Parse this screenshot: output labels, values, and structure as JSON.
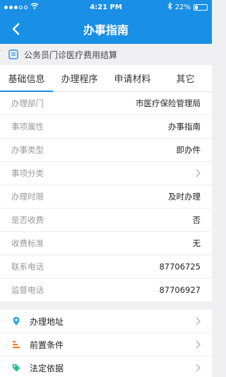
{
  "status_bar": {
    "time": "4:21 PM",
    "battery_percent": "22%",
    "battery_level": 0.22,
    "wifi_icon": "wifi-icon",
    "bluetooth_icon": "bluetooth-icon"
  },
  "nav": {
    "title": "办事指南",
    "back_icon": "back-chevron-icon"
  },
  "subject": {
    "title": "公务员门诊医疗费用结算",
    "icon": "document-icon"
  },
  "tabs": [
    {
      "label": "基础信息",
      "active": true
    },
    {
      "label": "办理程序",
      "active": false
    },
    {
      "label": "申请材料",
      "active": false
    },
    {
      "label": "其它",
      "active": false
    }
  ],
  "info_rows": [
    {
      "label": "办理部门",
      "value": "市医疗保险管理局"
    },
    {
      "label": "事项属性",
      "value": "办事指南"
    },
    {
      "label": "办事类型",
      "value": "即办件"
    },
    {
      "label": "事项分类",
      "value": ""
    },
    {
      "label": "办理时限",
      "value": "及时办理"
    },
    {
      "label": "是否收费",
      "value": "否"
    },
    {
      "label": "收费标准",
      "value": "无"
    },
    {
      "label": "联系电话",
      "value": "87706725"
    },
    {
      "label": "监督电话",
      "value": "87706927"
    }
  ],
  "links": [
    {
      "label": "办理地址",
      "icon": "location-pin-icon"
    },
    {
      "label": "前置条件",
      "icon": "bars-icon"
    },
    {
      "label": "法定依据",
      "icon": "tag-icon"
    }
  ],
  "colors": {
    "primary": "#1a8fe6",
    "location_icon": "#29a8e0",
    "bars_icon": "#f07a2a",
    "tag_icon": "#2bbf9c"
  }
}
